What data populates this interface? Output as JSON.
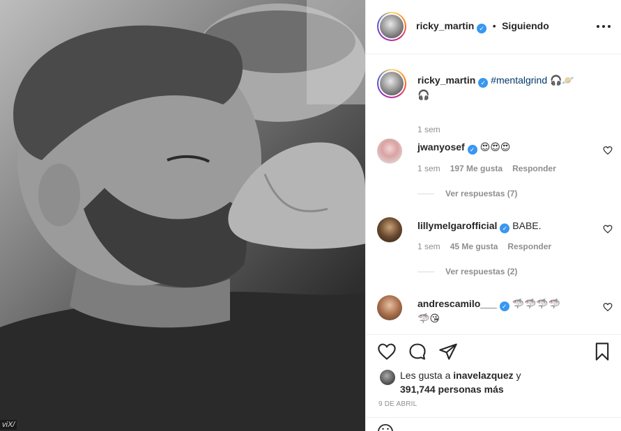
{
  "photo": {
    "watermark": "viX/"
  },
  "header": {
    "username": "ricky_martin",
    "separator": "•",
    "follow_status": "Siguiendo"
  },
  "caption": {
    "username": "ricky_martin",
    "hashtag": "#mentalgrind",
    "emojis": "🎧🪐",
    "emojis_line2": "🎧",
    "time": "1 sem"
  },
  "comments": [
    {
      "username": "jwanyosef",
      "text": "😍😍😍",
      "time": "1 sem",
      "likes": "197 Me gusta",
      "reply": "Responder",
      "view_replies": "Ver respuestas (7)"
    },
    {
      "username": "lillymelgarofficial",
      "text": "BABE.",
      "time": "1 sem",
      "likes": "45 Me gusta",
      "reply": "Responder",
      "view_replies": "Ver respuestas (2)"
    },
    {
      "username": "andrescamilo___",
      "text": "🦈🦈🦈🦈",
      "text_line2": "🦈😘"
    }
  ],
  "likes": {
    "prefix": "Les gusta a",
    "user": "inavelazquez",
    "suffix": "y",
    "count": "391,744 personas más"
  },
  "date": "9 DE ABRIL",
  "colors": {
    "verified": "#3897f0",
    "hashtag": "#00376b",
    "muted": "#8e8e8e",
    "text": "#262626"
  },
  "icons": [
    "heart-icon",
    "comment-icon",
    "share-icon",
    "bookmark-icon",
    "more-icon",
    "verified-icon"
  ]
}
